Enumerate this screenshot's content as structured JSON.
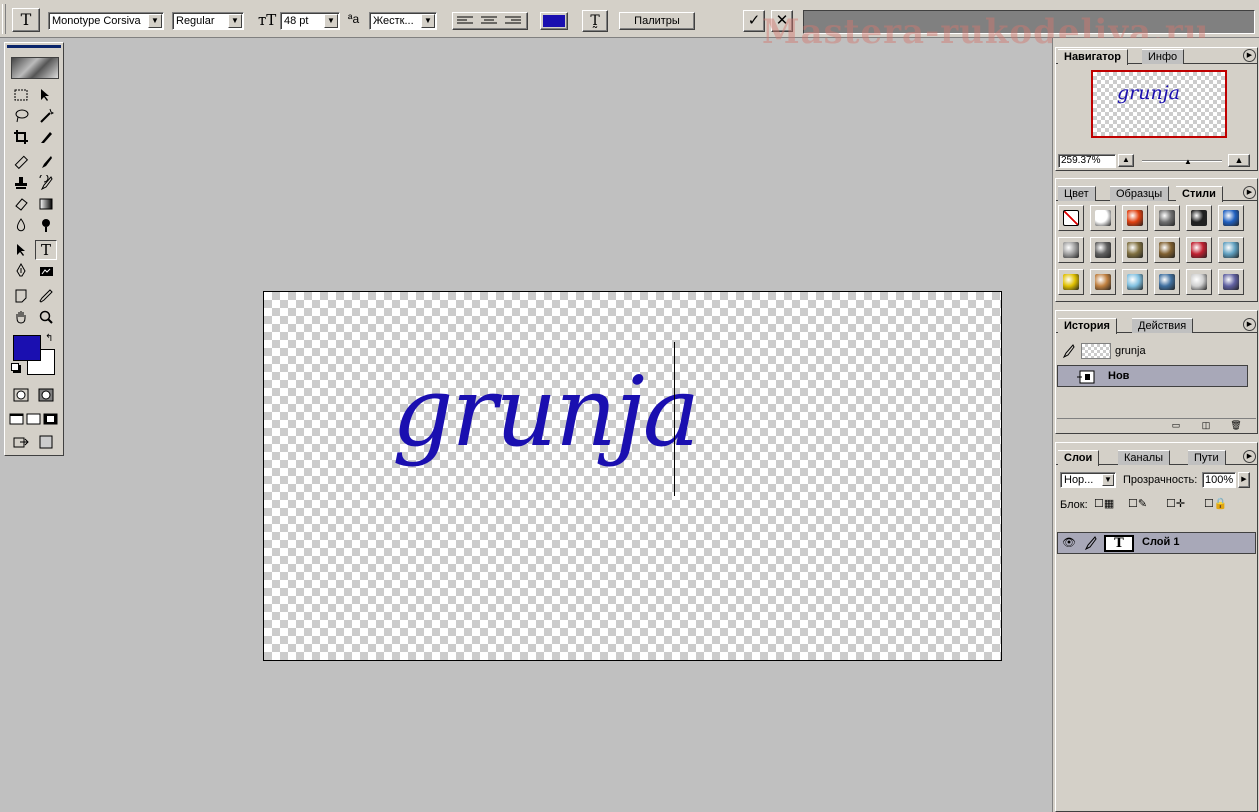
{
  "options_bar": {
    "tool_glyph": "T",
    "font_family": "Monotype Corsiva",
    "font_style": "Regular",
    "font_size": "48 pt",
    "antialias_glyph": "ªa",
    "antialias": "Жестк...",
    "text_color": "#1a0fb0",
    "palettes_label": "Палитры",
    "commit_glyph": "✓",
    "cancel_glyph": "✕"
  },
  "watermark": "Mastera-rukodeliya.ru",
  "canvas": {
    "text": "grunja"
  },
  "colors": {
    "foreground": "#1a0fb0",
    "background": "#ffffff"
  },
  "navigator": {
    "tabs": [
      "Навигатор",
      "Инфо"
    ],
    "preview_text": "grunja",
    "zoom": "259.37%"
  },
  "styles_palette": {
    "tabs": [
      "Цвет",
      "Образцы",
      "Стили"
    ],
    "swatches": [
      "#ffffff",
      "#e04010",
      "#707070",
      "#202020",
      "#2060c0",
      "#a0a0a0",
      "#606060",
      "#807040",
      "#806030",
      "#c02030",
      "#60a0c0",
      "#e0c000",
      "#c08040",
      "#80c0e0",
      "#4070a0",
      "#d0d0d0",
      "#6060a0"
    ]
  },
  "history": {
    "tabs": [
      "История",
      "Действия"
    ],
    "snapshot": "grunja",
    "step": "Нов"
  },
  "layers": {
    "tabs": [
      "Слои",
      "Каналы",
      "Пути"
    ],
    "blend_mode": "Нор...",
    "opacity_label": "Прозрачность:",
    "opacity": "100%",
    "lock_label": "Блок:",
    "layer_name": "Слой 1",
    "layer_thumb": "T"
  }
}
